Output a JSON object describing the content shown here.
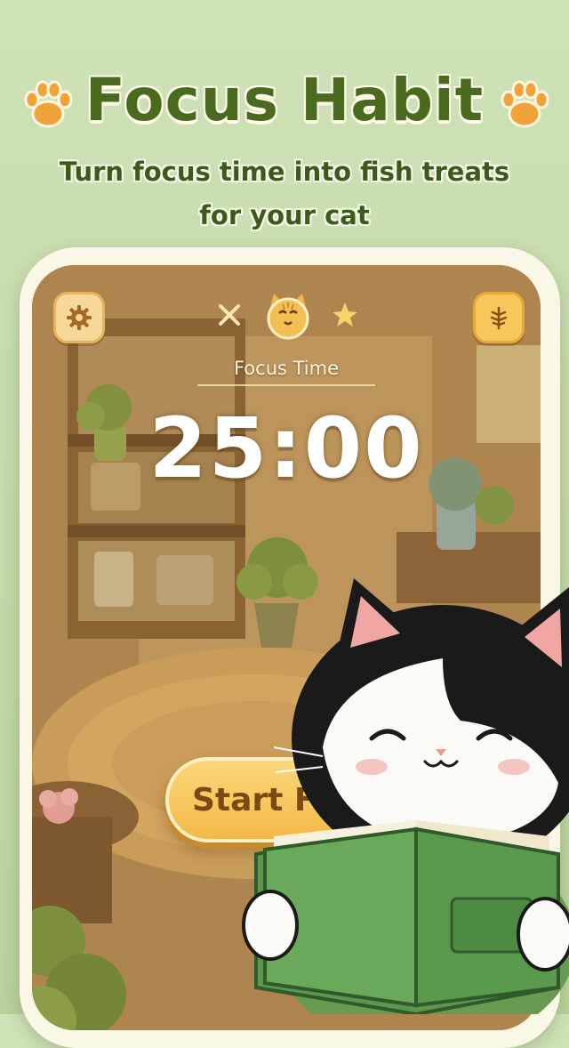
{
  "header": {
    "title": "Focus Habit",
    "subtitle_line1": "Turn focus time into fish treats",
    "subtitle_line2": "for your cat",
    "paw_icon": "paw-print-icon"
  },
  "screen": {
    "settings_icon": "gear-icon",
    "menu_icon": "fish-icon",
    "medal_icon": "cat-face-icon",
    "focus_label": "Focus Time",
    "timer": "25:00",
    "start_button_label": "Start Focus"
  },
  "colors": {
    "title_green": "#4a6b1f",
    "background": "#c3d9a9",
    "button_yellow": "#f3b948",
    "phone_frame": "#fbf7e6"
  }
}
